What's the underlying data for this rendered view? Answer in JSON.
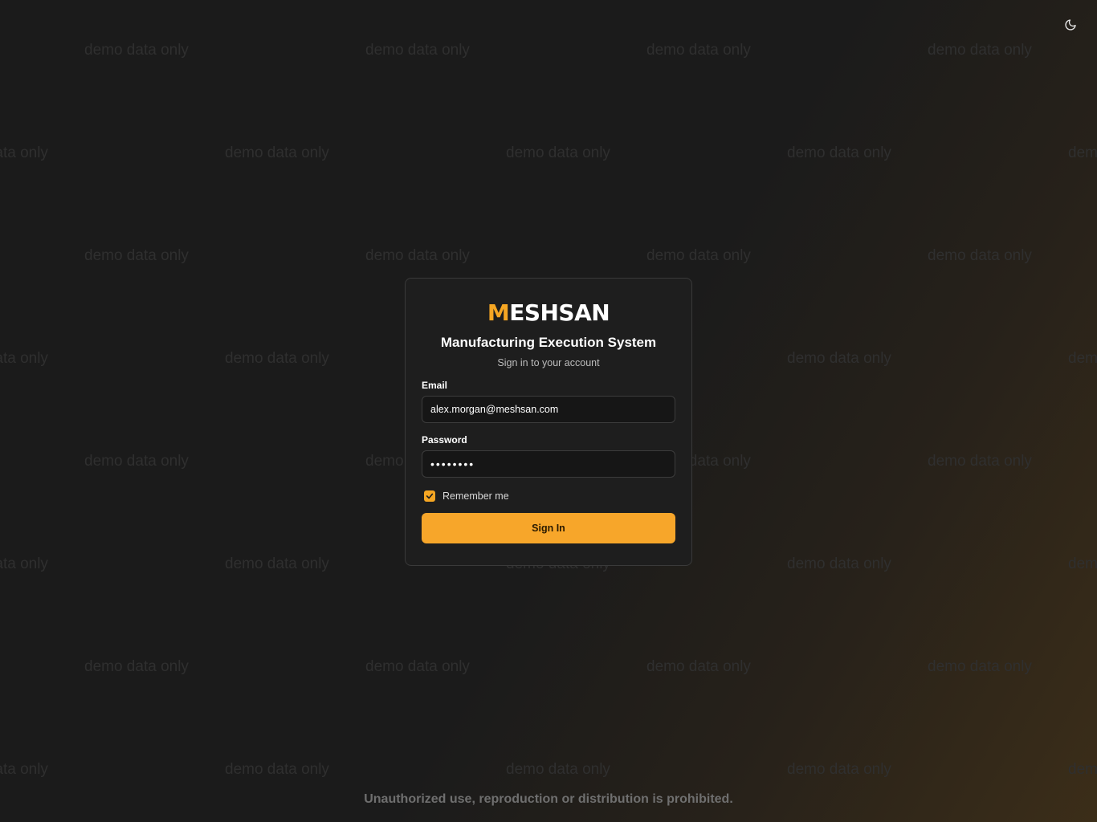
{
  "watermark_text": "demo data only",
  "theme_toggle": {
    "icon": "moon-icon"
  },
  "brand": {
    "logo_text": "MESHSAN",
    "accent_color": "#f5a623"
  },
  "login": {
    "title": "Manufacturing Execution System",
    "subtitle": "Sign in to your account",
    "email_label": "Email",
    "email_value": "alex.morgan@meshsan.com",
    "password_label": "Password",
    "password_value": "••••••••",
    "remember_label": "Remember me",
    "remember_checked": true,
    "submit_label": "Sign In"
  },
  "footer": {
    "notice": "Unauthorized use, reproduction or distribution is prohibited."
  }
}
